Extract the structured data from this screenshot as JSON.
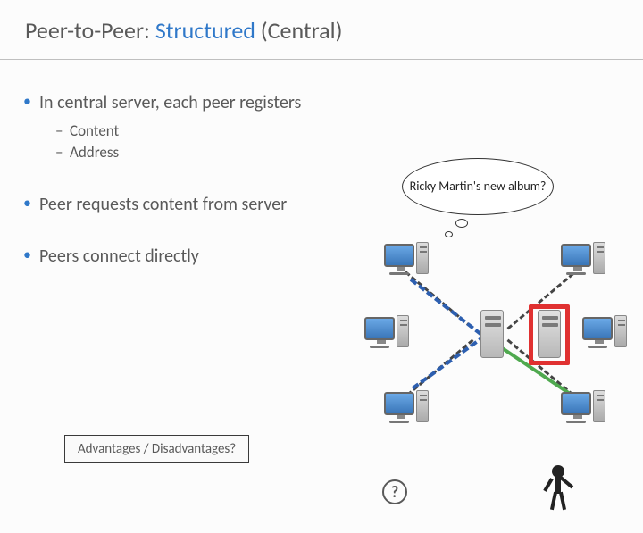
{
  "title": {
    "prefix": "Peer-to-Peer: ",
    "accent": "Structured",
    "suffix": " (Central)"
  },
  "bullets": {
    "b1": "In central server, each peer registers",
    "b1_sub1": "Content",
    "b1_sub2": "Address",
    "b2": "Peer requests content from server",
    "b3": "Peers connect directly"
  },
  "footer": "Advantages / Disadvantages?",
  "bubble": "Ricky Martin's new album?",
  "icons": {
    "question": "?"
  }
}
